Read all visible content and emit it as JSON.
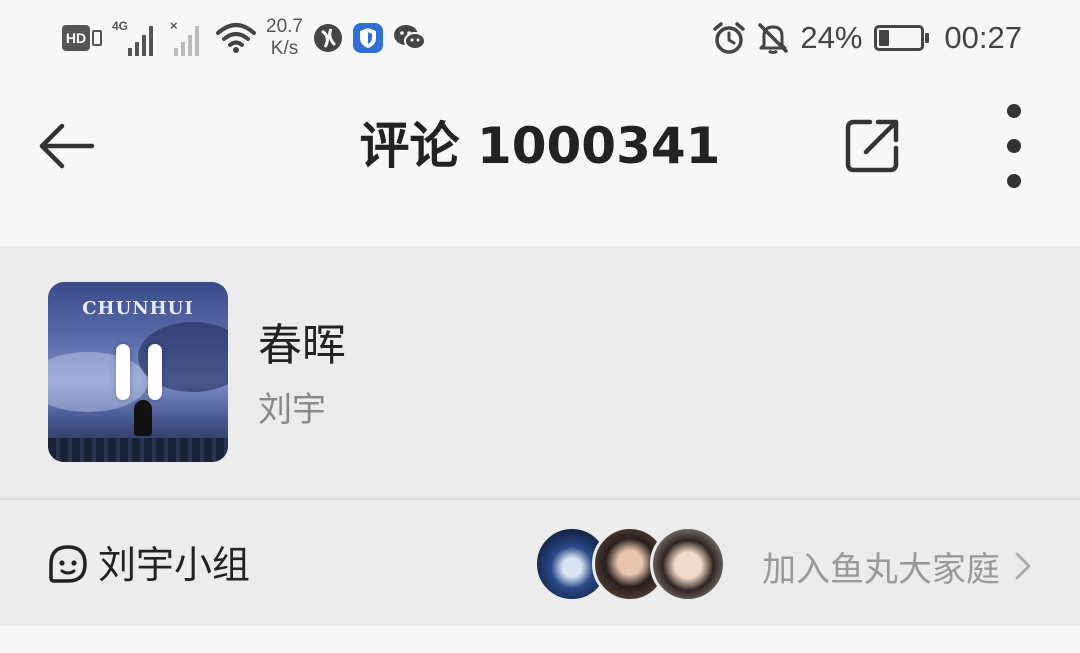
{
  "status_bar": {
    "net_speed_value": "20.7",
    "net_speed_unit": "K/s",
    "signal_label": "4G",
    "battery_percent": "24%",
    "battery_level": 0.24,
    "time": "00:27",
    "icons": [
      "hd-icon",
      "signal-4g-icon",
      "signal-no-sim-icon",
      "wifi-icon",
      "app-icon",
      "shield-icon",
      "wechat-icon",
      "alarm-icon",
      "mute-icon",
      "battery-icon"
    ]
  },
  "header": {
    "title": "评论 1000341",
    "back_icon": "arrow-left-icon",
    "share_icon": "share-icon",
    "more_icon": "more-vertical-icon"
  },
  "song": {
    "cover_text": "CHUNHUI",
    "title": "春晖",
    "artist": "刘宇",
    "state": "playing"
  },
  "group": {
    "name": "刘宇小组",
    "icon": "group-face-icon",
    "join_label": "加入鱼丸大家庭",
    "avatars": [
      "avatar-1",
      "avatar-2",
      "avatar-3"
    ]
  },
  "colors": {
    "background": "#f7f7f7",
    "card_background": "#ececec",
    "primary_text": "#222222",
    "secondary_text": "#888888"
  }
}
